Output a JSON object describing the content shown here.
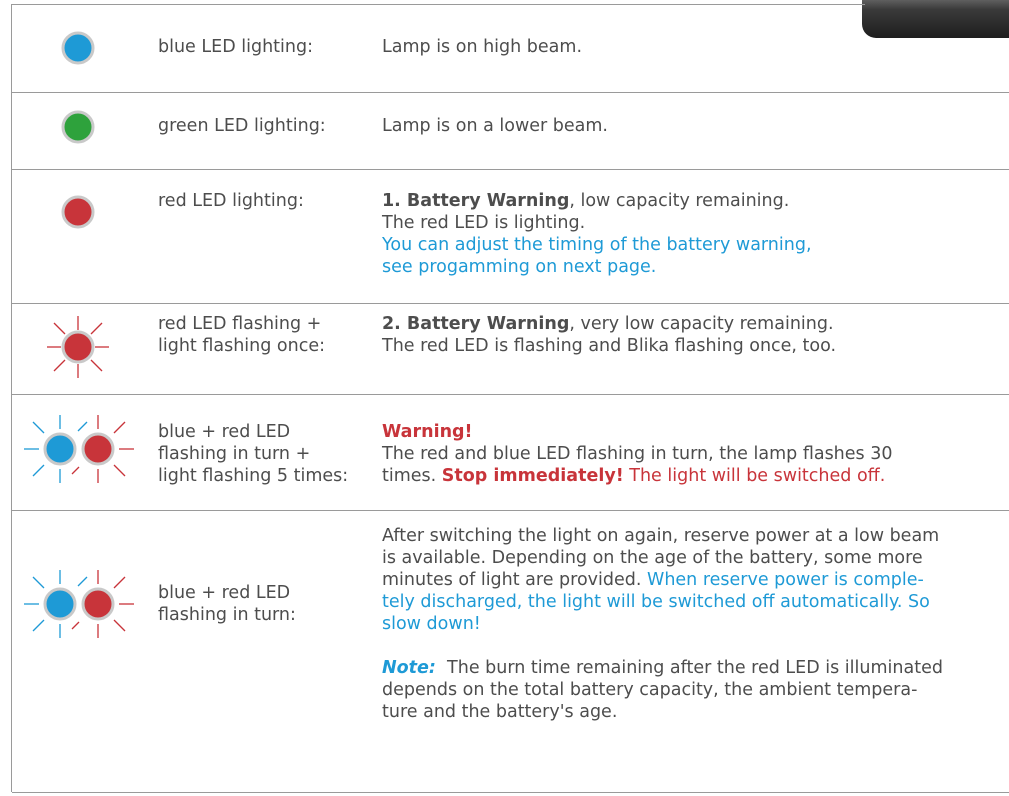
{
  "colors": {
    "blue": "#1e9ad6",
    "green": "#2ea23c",
    "red": "#c8343a",
    "text": "#4d4d4d",
    "rule": "#9a9a9a"
  },
  "rows": [
    {
      "icon": "blue-led-icon",
      "label": "blue LED lighting:",
      "desc": "Lamp is on high beam."
    },
    {
      "icon": "green-led-icon",
      "label": "green LED lighting:",
      "desc": "Lamp is on a lower beam."
    },
    {
      "icon": "red-led-icon",
      "label": "red LED lighting:",
      "bold": "1. Battery Warning",
      "rest": ", low capacity remaining.",
      "line2": "The red LED is lighting.",
      "blue1": "You can adjust the timing of the battery warning,",
      "blue2": "see progamming on next page."
    },
    {
      "icon": "red-led-flashing-icon",
      "label1": "red LED flashing +",
      "label2": "light flashing once:",
      "bold": "2. Battery Warning",
      "rest": ", very low capacity remaining.",
      "line2": "The red LED is flashing and Blika flashing once, too."
    },
    {
      "icon": "blue-red-led-flashing-icon",
      "label1": "blue + red LED",
      "label2": "flashing in turn +",
      "label3": "light flashing 5 times:",
      "warning": "Warning!",
      "line1": "The red and blue LED flashing in turn, the lamp flashes 30",
      "line2a": "times.",
      "stop": "Stop immediately!",
      "line2b": "The light will be switched off."
    },
    {
      "icon": "blue-red-led-flashing-icon",
      "label1": "blue + red LED",
      "label2": "flashing in turn:",
      "p1": "After switching the light on again, reserve power at a low beam",
      "p2": "is available. Depending on the age of the battery, some more",
      "p3a": "minutes of light are provided.",
      "p3b": "When reserve power is comple-",
      "p4": "tely discharged, the light will be switched off automatically. So",
      "p5": "slow down!",
      "note_label": "Note:",
      "n1": "The burn time remaining after the red LED is illuminated",
      "n2": "depends on the total battery capacity, the ambient tempera-",
      "n3": "ture and the battery's age."
    }
  ]
}
